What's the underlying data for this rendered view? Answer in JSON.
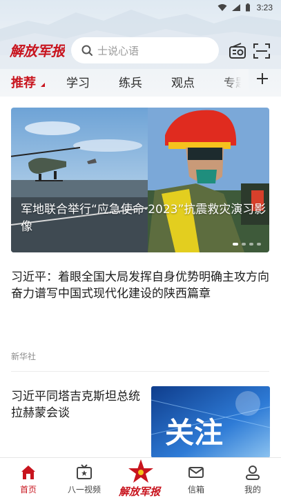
{
  "status_bar": {
    "time": "3:23"
  },
  "header": {
    "logo_text": "解放军报",
    "search_placeholder": "士说心语"
  },
  "tabs": [
    {
      "label": "推荐",
      "active": true
    },
    {
      "label": "学习"
    },
    {
      "label": "练兵"
    },
    {
      "label": "观点"
    },
    {
      "label": "专题"
    }
  ],
  "carousel": {
    "caption": "军地联合举行“应急使命·2023”抗震救灾演习影像",
    "slide_count": 4,
    "active_index": 0
  },
  "articles": [
    {
      "title": "习近平：着眼全国大局发挥自身优势明确主攻方向 奋力谱写中国式现代化建设的陕西篇章"
    },
    {
      "source": "新华社"
    },
    {
      "title": "习近平同塔吉克斯坦总统拉赫蒙会谈",
      "thumb_text": "关注"
    }
  ],
  "bottom_nav": [
    {
      "label": "首页",
      "icon": "home-icon",
      "active": true
    },
    {
      "label": "八一视频",
      "icon": "tv-icon"
    },
    {
      "label": "解放军报",
      "icon": "pla-star-logo"
    },
    {
      "label": "信箱",
      "icon": "mail-icon"
    },
    {
      "label": "我的",
      "icon": "user-icon"
    }
  ],
  "colors": {
    "accent": "#c8141e",
    "header_bg": "#e6edf3"
  }
}
